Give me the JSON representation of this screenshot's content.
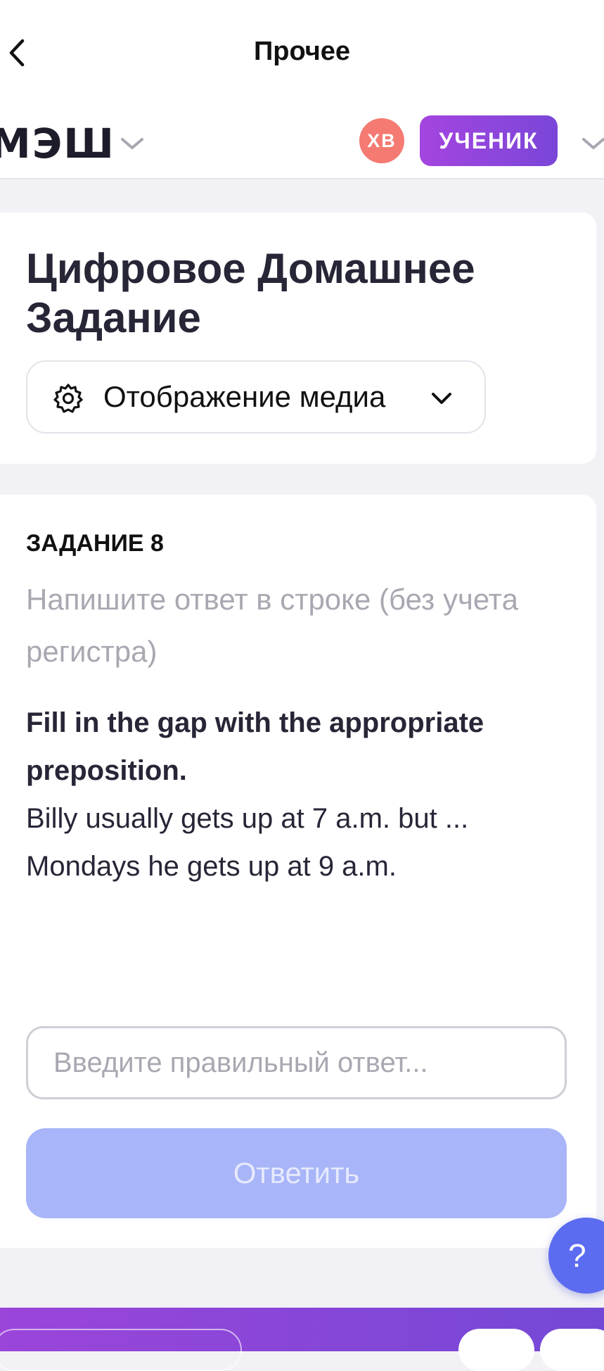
{
  "navbar": {
    "title": "Прочее",
    "back_icon": "chevron-left-icon"
  },
  "header": {
    "logo_text": "МЭШ",
    "avatar_initials": "ХВ",
    "role_badge": "УЧЕНИК",
    "colors": {
      "avatar": "#f47a72",
      "badge_start": "#a445df",
      "badge_end": "#7a46d8"
    }
  },
  "intro_card": {
    "title": "Цифровое Домашнее Задание",
    "media_select": {
      "label": "Отображение медиа",
      "icon": "gear-icon"
    }
  },
  "task": {
    "label": "ЗАДАНИЕ 8",
    "hint": "Напишите ответ в строке (без учета регистра)",
    "question_bold": "Fill in the gap with the appropriate preposition.",
    "question_text": "Billy usually gets up at 7 a.m. but ... Mondays he gets up at 9 a.m.",
    "answer": {
      "value": "",
      "placeholder": "Введите правильный ответ..."
    },
    "submit_label": "Ответить",
    "colors": {
      "submit_bg": "#a8b5f8"
    }
  },
  "help": {
    "label": "?",
    "color": "#5b6cf0"
  }
}
